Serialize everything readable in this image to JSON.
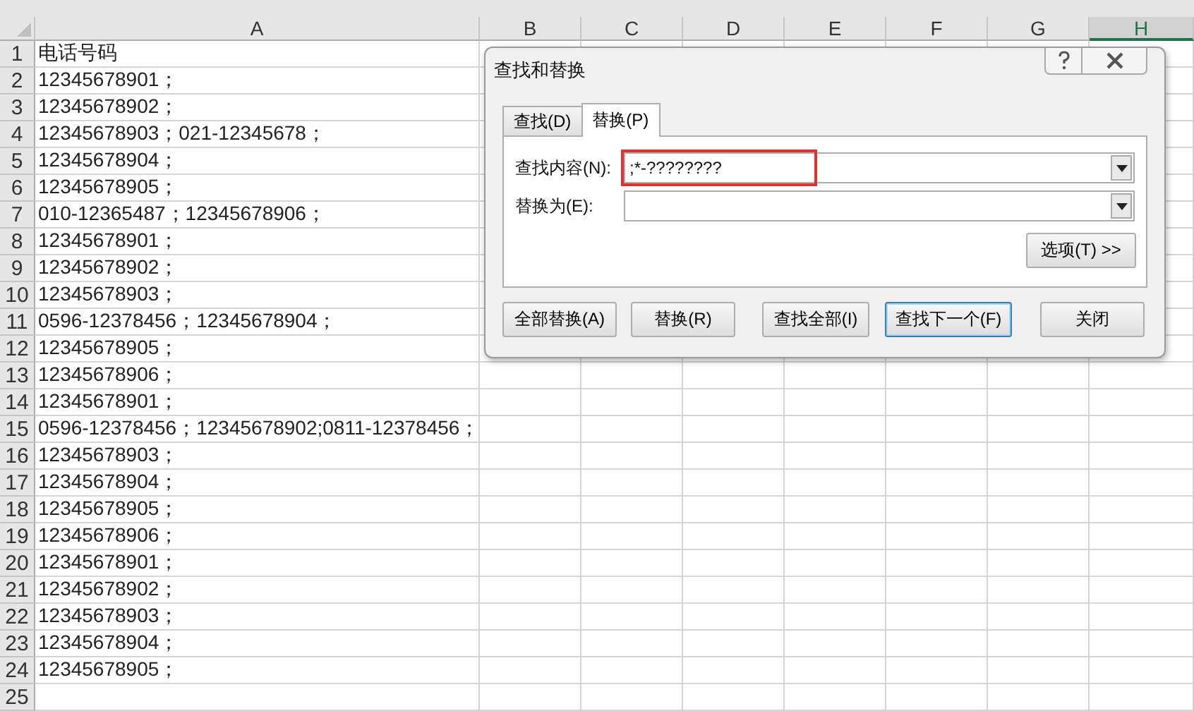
{
  "columns": [
    {
      "label": "A",
      "selected": false
    },
    {
      "label": "B",
      "selected": false
    },
    {
      "label": "C",
      "selected": false
    },
    {
      "label": "D",
      "selected": false
    },
    {
      "label": "E",
      "selected": false
    },
    {
      "label": "F",
      "selected": false
    },
    {
      "label": "G",
      "selected": false
    },
    {
      "label": "H",
      "selected": true
    }
  ],
  "rows": [
    {
      "number": "1",
      "a": "电话号码"
    },
    {
      "number": "2",
      "a": "12345678901；"
    },
    {
      "number": "3",
      "a": "12345678902；"
    },
    {
      "number": "4",
      "a": "12345678903；021-12345678；"
    },
    {
      "number": "5",
      "a": "12345678904；"
    },
    {
      "number": "6",
      "a": "12345678905；"
    },
    {
      "number": "7",
      "a": "010-12365487；12345678906；"
    },
    {
      "number": "8",
      "a": "12345678901；"
    },
    {
      "number": "9",
      "a": "12345678902；"
    },
    {
      "number": "10",
      "a": "12345678903；"
    },
    {
      "number": "11",
      "a": "0596-12378456；12345678904；"
    },
    {
      "number": "12",
      "a": "12345678905；"
    },
    {
      "number": "13",
      "a": "12345678906；"
    },
    {
      "number": "14",
      "a": "12345678901；"
    },
    {
      "number": "15",
      "a": "0596-12378456；12345678902;0811-12378456；"
    },
    {
      "number": "16",
      "a": "12345678903；"
    },
    {
      "number": "17",
      "a": "12345678904；"
    },
    {
      "number": "18",
      "a": "12345678905；"
    },
    {
      "number": "19",
      "a": "12345678906；"
    },
    {
      "number": "20",
      "a": "12345678901；"
    },
    {
      "number": "21",
      "a": "12345678902；"
    },
    {
      "number": "22",
      "a": "12345678903；"
    },
    {
      "number": "23",
      "a": "12345678904；"
    },
    {
      "number": "24",
      "a": "12345678905；"
    },
    {
      "number": "25"
    }
  ],
  "dialog": {
    "title": "查找和替换",
    "tabs": [
      {
        "label": "查找(D)",
        "selected": false
      },
      {
        "label": "替换(P)",
        "selected": true
      }
    ],
    "fields": [
      {
        "label": "查找内容(N):",
        "value": ";*-????????",
        "highlighted": true
      },
      {
        "label": "替换为(E):",
        "highlighted": false
      }
    ],
    "options_button": "选项(T) >>",
    "buttons": [
      {
        "label": "全部替换(A)",
        "default": false
      },
      {
        "label": "替换(R)",
        "default": false
      },
      {
        "label": "查找全部(I)",
        "default": false
      },
      {
        "label": "查找下一个(F)",
        "default": true
      },
      {
        "label": "关闭",
        "default": false
      }
    ]
  }
}
